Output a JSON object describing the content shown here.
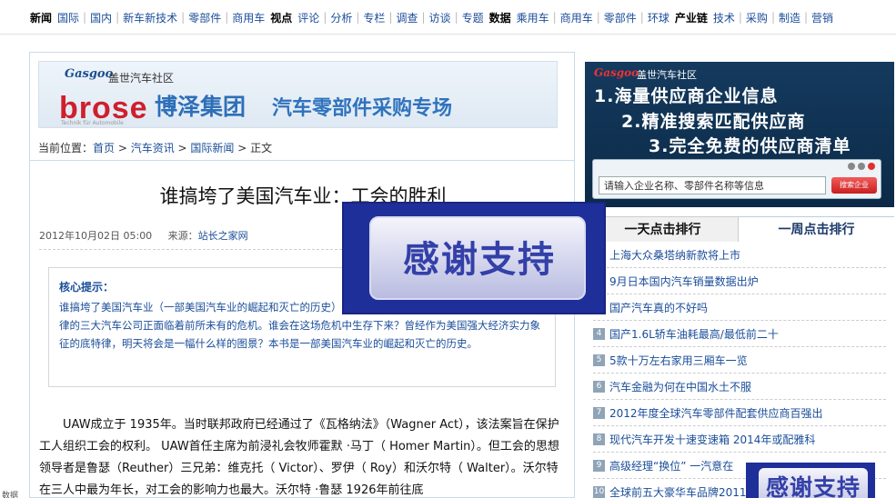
{
  "nav": {
    "items": [
      {
        "label": "新闻",
        "bold": true
      },
      {
        "label": "国际"
      },
      {
        "label": "国内"
      },
      {
        "label": "新车新技术"
      },
      {
        "label": "零部件"
      },
      {
        "label": "商用车"
      },
      {
        "label": "视点",
        "bold": true
      },
      {
        "label": "评论"
      },
      {
        "label": "分析"
      },
      {
        "label": "专栏"
      },
      {
        "label": "调查"
      },
      {
        "label": "访谈"
      },
      {
        "label": "专题"
      },
      {
        "label": "数据",
        "bold": true
      },
      {
        "label": "乘用车"
      },
      {
        "label": "商用车"
      },
      {
        "label": "零部件"
      },
      {
        "label": "环球"
      },
      {
        "label": "产业链",
        "bold": true
      },
      {
        "label": "技术"
      },
      {
        "label": "采购"
      },
      {
        "label": "制造"
      },
      {
        "label": "营销"
      }
    ]
  },
  "banner": {
    "logo": "Gasgoo",
    "community": "盖世汽车社区",
    "brand": "brose",
    "brand_sub": "Technik für Automobile",
    "group": "博泽集团",
    "slogan": "汽车零部件采购专场"
  },
  "breadcrumb": {
    "prefix": "当前位置：",
    "items": [
      "首页",
      "汽车资讯",
      "国际新闻"
    ],
    "current": "正文",
    "sep": " > "
  },
  "article": {
    "title": "谁搞垮了美国汽车业：工会的胜利",
    "date": "2012年10月02日  05:00",
    "source_label": "来源：",
    "source": "站长之家网",
    "summary_heading": "核心提示：",
    "summary_text": "谁搞垮了美国汽车业（一部美国汽车业的崛起和灭亡的历史）...济衰退和来自海外汽车企业的冲击，底特律的三大汽车公司正面临着前所未有的危机。谁会在这场危机中生存下来？曾经作为美国强大经济实力象征的底特律，明天将会是一幅什么样的图景？本书是一部美国汽车业的崛起和灭亡的历史。",
    "body": "UAW成立于 1935年。当时联邦政府已经通过了《瓦格纳法》（Wagner Act），该法案旨在保护工人组织工会的权利。 UAW首任主席为前浸礼会牧师霍默 ·马丁（ Homer Martin）。但工会的思想领导者是鲁瑟（Reuther）三兄弟：维克托（ Victor）、罗伊（ Roy）和沃尔特（ Walter）。沃尔特在三人中最为年长，对工会的影响力也最大。沃尔特 ·鲁瑟 1926年前往底"
  },
  "ad": {
    "logo": "Gasgoo",
    "community": "盖世汽车社区",
    "lines": [
      "1.海量供应商企业信息",
      "2.精准搜索匹配供应商",
      "3.完全免费的供应商清单"
    ],
    "search_placeholder": "请输入企业名称、零部件名称等信息",
    "search_button": "搜索企业"
  },
  "ranking": {
    "tabs": [
      "一天点击排行",
      "一周点击排行"
    ],
    "items": [
      {
        "num": "1",
        "title": "上海大众桑塔纳新款将上市"
      },
      {
        "num": "2",
        "title": "9月日本国内汽车销量数据出炉"
      },
      {
        "num": "3",
        "title": "国产汽车真的不好吗"
      },
      {
        "num": "4",
        "title": "国产1.6L轿车油耗最高/最低前二十"
      },
      {
        "num": "5",
        "title": "5款十万左右家用三厢车一览"
      },
      {
        "num": "6",
        "title": "汽车金融为何在中国水土不服"
      },
      {
        "num": "7",
        "title": "2012年度全球汽车零部件配套供应商百强出"
      },
      {
        "num": "8",
        "title": "现代汽车开发十速变速箱 2014年或配雅科"
      },
      {
        "num": "9",
        "title": "高级经理“换位”  一汽意在"
      },
      {
        "num": "10",
        "title": "全球前五大豪华车品牌2011年"
      }
    ]
  },
  "overlay": {
    "thanks_text": "感谢支持"
  },
  "corner": {
    "label": "数据"
  },
  "colors": {
    "link": "#1a4d99",
    "overlay_bg": "#1f2f9a",
    "brand_red": "#cf1f2e",
    "rank_hot": "#e0422f"
  }
}
